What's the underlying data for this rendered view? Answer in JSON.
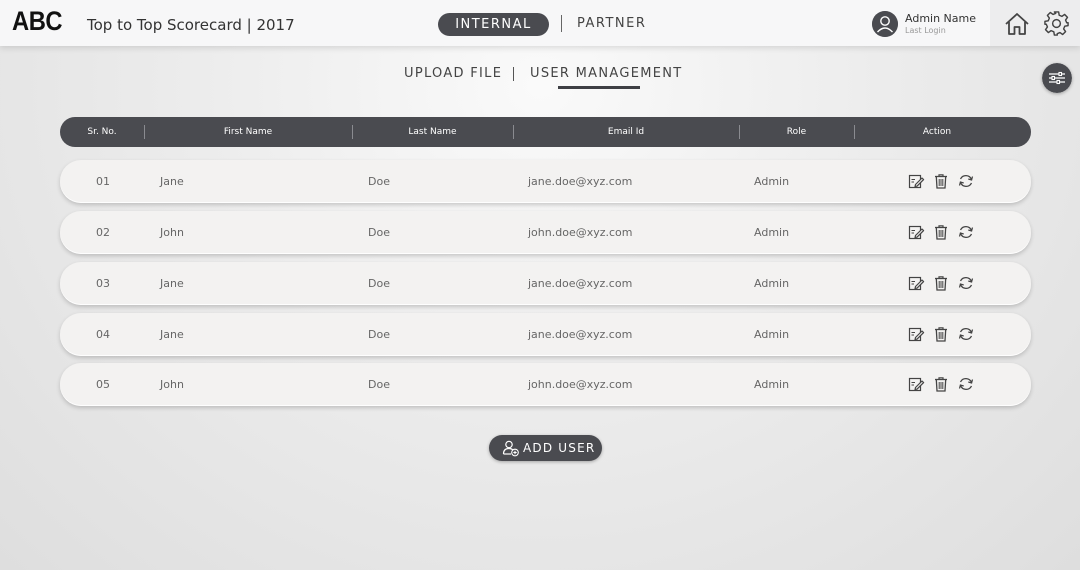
{
  "header": {
    "logo": "ABC",
    "title": "Top to Top Scorecard | 2017",
    "toggle": {
      "active": "INTERNAL",
      "inactive": "PARTNER"
    },
    "user": {
      "name": "Admin Name",
      "last_login": "Last Login"
    }
  },
  "subnav": {
    "upload": "UPLOAD FILE",
    "users": "USER MANAGEMENT"
  },
  "table": {
    "columns": [
      "Sr. No.",
      "First Name",
      "Last Name",
      "Email Id",
      "Role",
      "Action"
    ],
    "rows": [
      {
        "sr": "01",
        "first": "Jane",
        "last": "Doe",
        "email": "jane.doe@xyz.com",
        "role": "Admin"
      },
      {
        "sr": "02",
        "first": "John",
        "last": "Doe",
        "email": "john.doe@xyz.com",
        "role": "Admin"
      },
      {
        "sr": "03",
        "first": "Jane",
        "last": "Doe",
        "email": "jane.doe@xyz.com",
        "role": "Admin"
      },
      {
        "sr": "04",
        "first": "Jane",
        "last": "Doe",
        "email": "jane.doe@xyz.com",
        "role": "Admin"
      },
      {
        "sr": "05",
        "first": "John",
        "last": "Doe",
        "email": "john.doe@xyz.com",
        "role": "Admin"
      }
    ],
    "actions": [
      "edit-icon",
      "trash-icon",
      "refresh-icon"
    ]
  },
  "add_user": {
    "label": "ADD USER"
  },
  "colors": {
    "dark": "#4a4b50",
    "row_bg": "#f3f2f1",
    "page_bg": "#e6e6e6"
  }
}
